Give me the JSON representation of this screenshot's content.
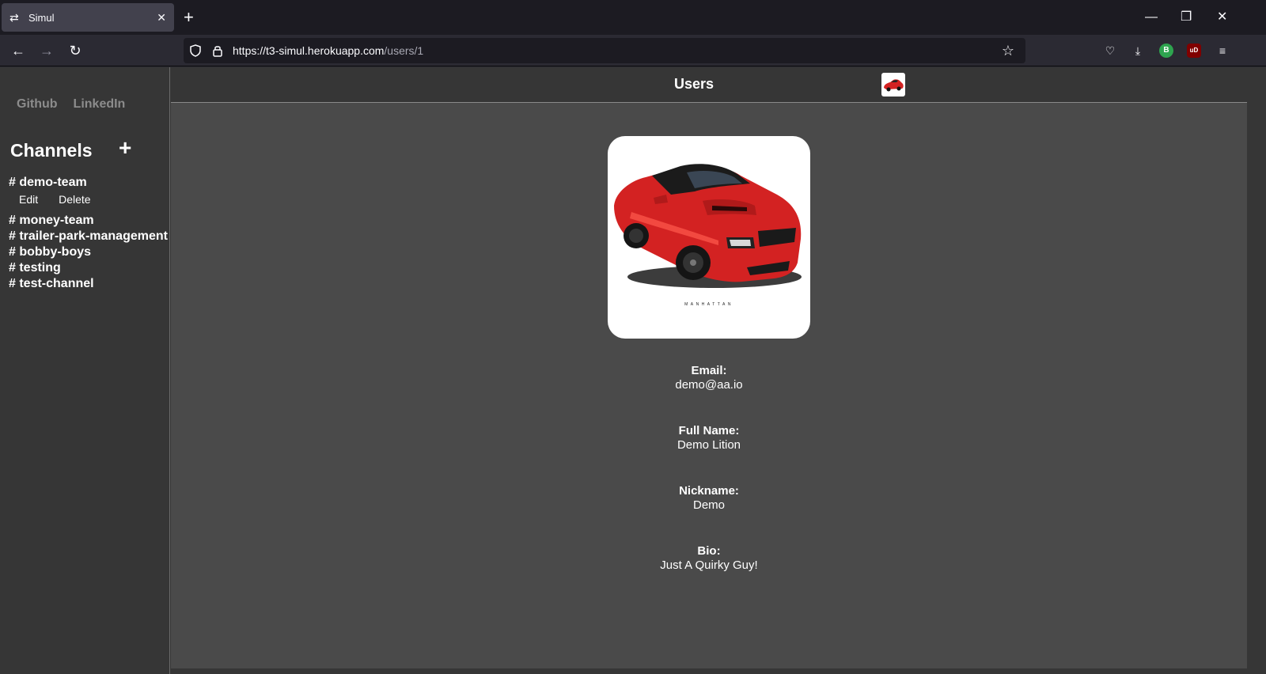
{
  "browser": {
    "tab_title": "Simul",
    "url_host": "https://t3-simul.herokuapp.com",
    "url_path": "/users/1",
    "ext_badge": "B",
    "ext_ublock": "uD"
  },
  "sidebar": {
    "links": [
      "Github",
      "LinkedIn"
    ],
    "channels_title": "Channels",
    "add_label": "+",
    "channels": [
      {
        "name": "# demo-team",
        "actions": [
          "Edit",
          "Delete"
        ]
      },
      {
        "name": "# money-team"
      },
      {
        "name": "# trailer-park-management"
      },
      {
        "name": "# bobby-boys"
      },
      {
        "name": "# testing"
      },
      {
        "name": "# test-channel"
      }
    ]
  },
  "header": {
    "title": "Users"
  },
  "profile": {
    "email_label": "Email:",
    "email": "demo@aa.io",
    "full_name_label": "Full Name:",
    "full_name": "Demo Lition",
    "nickname_label": "Nickname:",
    "nickname": "Demo",
    "bio_label": "Bio:",
    "bio": "Just A Quirky Guy!",
    "image_caption": "MANHATTAN"
  },
  "colors": {
    "accent_car": "#d32222",
    "page_bg": "#4a4a4a",
    "sidebar_bg": "#363636"
  }
}
